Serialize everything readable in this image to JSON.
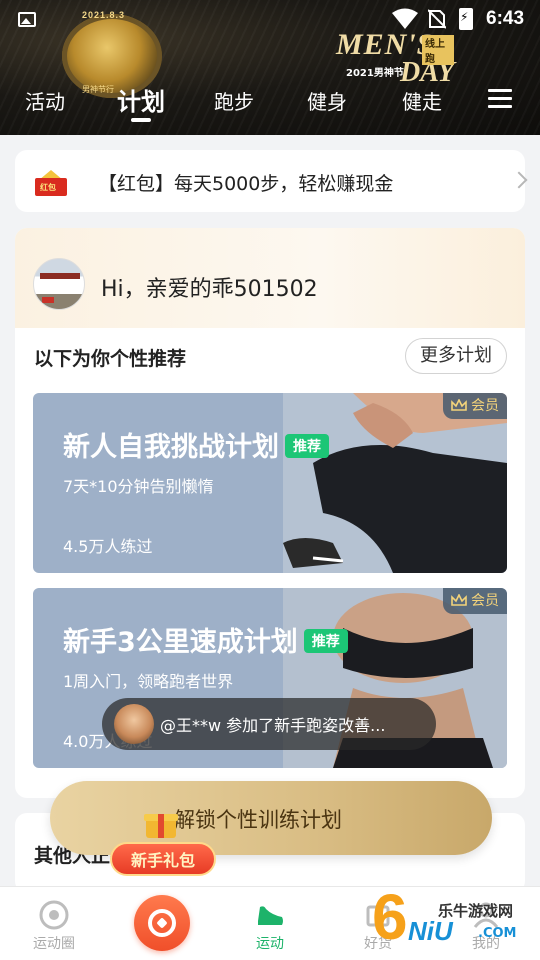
{
  "status_bar": {
    "time": "6:43"
  },
  "header": {
    "medal_top_text": "2021.8.3",
    "medal_bottom_text": "男神节行",
    "event_title_line1": "MEN'S",
    "event_title_line2": "DAY",
    "event_tag": "线上跑",
    "event_sub": "2021男神节",
    "tabs": [
      {
        "label": "活动",
        "active": false
      },
      {
        "label": "计划",
        "active": true
      },
      {
        "label": "跑步",
        "active": false
      },
      {
        "label": "健身",
        "active": false
      },
      {
        "label": "健走",
        "active": false
      }
    ]
  },
  "banner": {
    "icon_text": "红包",
    "text": "【红包】每天5000步，轻松赚现金"
  },
  "profile": {
    "greeting": "Hi，亲爱的乖501502"
  },
  "recommend": {
    "title": "以下为你个性推荐",
    "more_label": "更多计划",
    "plans": [
      {
        "title": "新人自我挑战计划",
        "tag": "推荐",
        "subtitle": "7天*10分钟告别懒惰",
        "count": "4.5万人练过",
        "vip_label": "会员"
      },
      {
        "title": "新手3公里速成计划",
        "tag": "推荐",
        "subtitle": "1周入门，领略跑者世界",
        "count": "4.0万人练过",
        "vip_label": "会员"
      }
    ]
  },
  "toast": {
    "text": "@王**w 参加了新手跑姿改善..."
  },
  "unlock_button": {
    "label": "解锁个性训练计划"
  },
  "section2": {
    "title": "其他人正在练"
  },
  "gift": {
    "label": "新手礼包"
  },
  "bottom_nav": [
    {
      "label": "运动圈",
      "active": false
    },
    {
      "label": "",
      "active": false
    },
    {
      "label": "运动",
      "active": true
    },
    {
      "label": "好货",
      "active": false
    },
    {
      "label": "我的",
      "active": false
    }
  ],
  "watermark": {
    "top": "乐牛游戏网",
    "bottom": "NiU",
    "com": ".COM",
    "digit": "6"
  },
  "colors": {
    "accent_green": "#1db36a",
    "tag_green": "#1cc676",
    "gift_red": "#e73b25",
    "gold": "#d9bd84"
  }
}
